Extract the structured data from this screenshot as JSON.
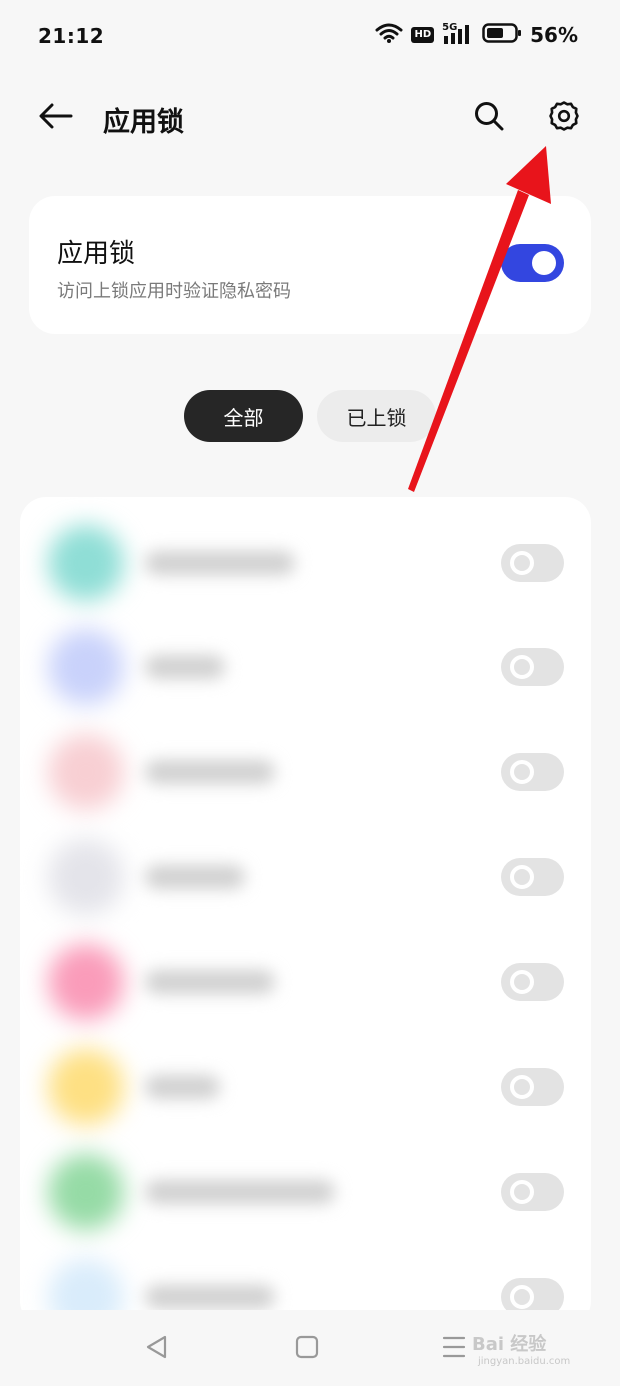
{
  "status_bar": {
    "time": "21:12",
    "hd_label": "HD",
    "network_label": "5G",
    "battery": "56%"
  },
  "header": {
    "title": "应用锁",
    "icons": {
      "back": "arrow-left",
      "search": "search",
      "settings": "gear"
    }
  },
  "master_toggle": {
    "title": "应用锁",
    "subtitle": "访问上锁应用时验证隐私密码",
    "enabled": true
  },
  "filter_tabs": [
    {
      "label": "全部",
      "selected": true
    },
    {
      "label": "已上锁",
      "selected": false
    }
  ],
  "app_list": {
    "names_blurred": true,
    "rows": [
      {
        "icon_color": "#8fded6",
        "enabled": false
      },
      {
        "icon_color": "#c9d2fb",
        "enabled": false
      },
      {
        "icon_color": "#f8cfd3",
        "enabled": false
      },
      {
        "icon_color": "#e4e4ea",
        "enabled": false
      },
      {
        "icon_color": "#fa9cba",
        "enabled": false
      },
      {
        "icon_color": "#fee083",
        "enabled": false
      },
      {
        "icon_color": "#96dba6",
        "enabled": false
      },
      {
        "icon_color": "#d9ecfb",
        "enabled": false
      }
    ]
  },
  "colors": {
    "accent": "#3346e0",
    "annotation_arrow": "#e8141b",
    "chip_selected": "#262626"
  },
  "watermark": {
    "brand": "Bai 经验",
    "url": "jingyan.baidu.com"
  }
}
